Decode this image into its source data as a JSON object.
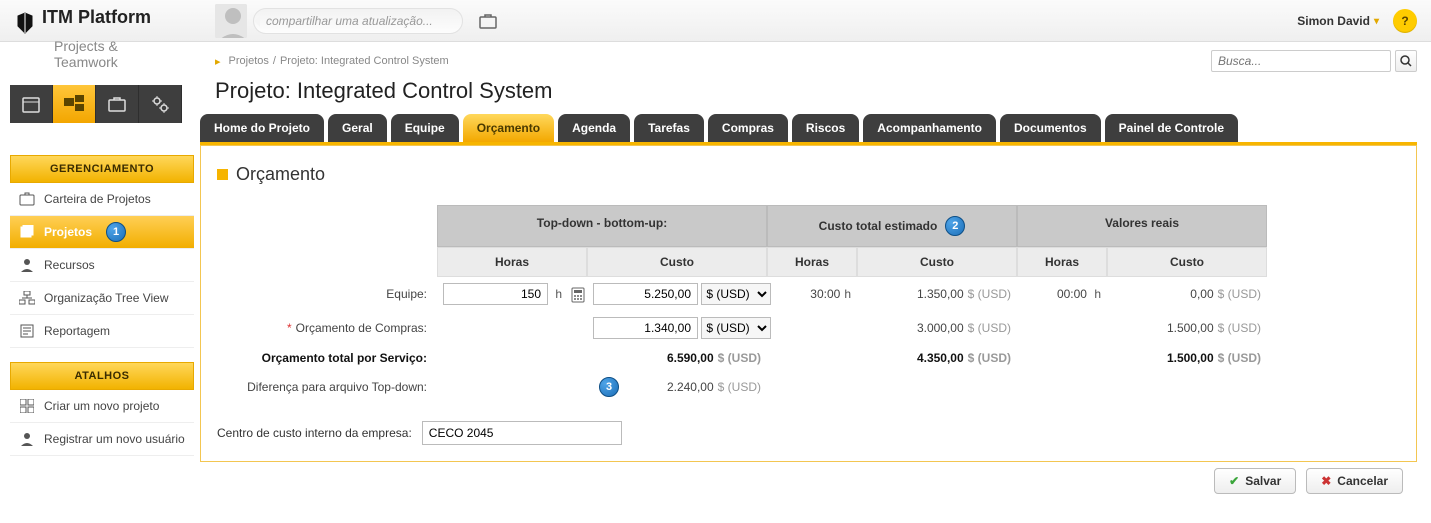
{
  "brand": {
    "name": "ITM Platform",
    "sub": "Projects & Teamwork"
  },
  "share": {
    "placeholder": "compartilhar uma atualização..."
  },
  "user": {
    "name": "Simon David"
  },
  "breadcrumb": {
    "root": "Projetos",
    "current": "Projeto: Integrated Control System"
  },
  "search": {
    "placeholder": "Busca..."
  },
  "page": {
    "title": "Projeto: Integrated Control System"
  },
  "sidebar": {
    "section_a_title": "GERENCIAMENTO",
    "section_b_title": "ATALHOS",
    "items_a": [
      {
        "label": "Carteira de Projetos"
      },
      {
        "label": "Projetos"
      },
      {
        "label": "Recursos"
      },
      {
        "label": "Organização Tree View"
      },
      {
        "label": "Reportagem"
      }
    ],
    "items_b": [
      {
        "label": "Criar um novo projeto"
      },
      {
        "label": "Registrar um novo usuário"
      }
    ],
    "badge1": "1"
  },
  "tabs": {
    "items": [
      "Home do Projeto",
      "Geral",
      "Equipe",
      "Orçamento",
      "Agenda",
      "Tarefas",
      "Compras",
      "Riscos",
      "Acompanhamento",
      "Documentos",
      "Painel de Controle"
    ],
    "active_index": 3
  },
  "panel": {
    "title": "Orçamento"
  },
  "table": {
    "group_td": "Top-down - bottom-up:",
    "group_est": "Custo total estimado",
    "group_real": "Valores reais",
    "sub_hours": "Horas",
    "sub_cost": "Custo",
    "badge2": "2",
    "badge3": "3",
    "rows": {
      "team_label": "Equipe:",
      "purchase_label": "Orçamento de Compras:",
      "total_label": "Orçamento total por Serviço:",
      "diff_label": "Diferença para arquivo Top-down:",
      "cost_center_label": "Centro de custo interno da empresa:"
    },
    "values": {
      "team_hours_input": "150",
      "team_cost_input": "5.250,00",
      "team_est_hours": "30:00",
      "team_est_cost": "1.350,00",
      "team_real_hours": "00:00",
      "team_real_cost": "0,00",
      "purchase_cost_input": "1.340,00",
      "purchase_est_cost": "3.000,00",
      "purchase_real_cost": "1.500,00",
      "total_td_cost": "6.590,00",
      "total_est_cost": "4.350,00",
      "total_real_cost": "1.500,00",
      "diff_td_cost": "2.240,00",
      "ccy_option": "$ (USD)",
      "cost_center_value": "CECO 2045"
    },
    "units": {
      "usd": "$ (USD)",
      "h": "h"
    }
  },
  "buttons": {
    "save": "Salvar",
    "cancel": "Cancelar"
  }
}
